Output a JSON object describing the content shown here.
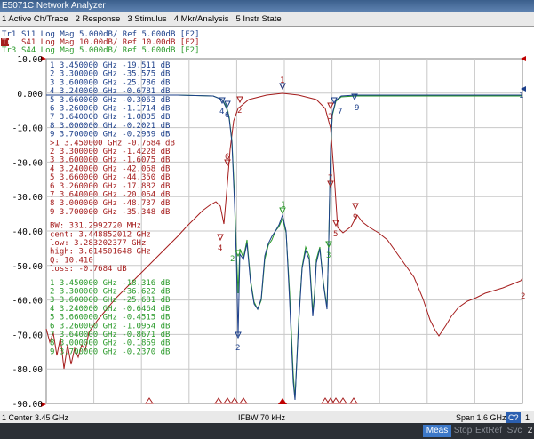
{
  "window_title": "E5071C Network Analyzer",
  "menu": [
    "1 Active Ch/Trace",
    "2 Response",
    "3 Stimulus",
    "4 Mkr/Analysis",
    "5 Instr State"
  ],
  "traces": [
    {
      "name": "Tr1",
      "text": " S11 Log Mag 5.000dB/ Ref 5.000dB [F2]",
      "color": "#1c3f8a",
      "active": false
    },
    {
      "name": "Tr2",
      "text": " S41 Log Mag 10.00dB/ Ref 10.00dB [F2]",
      "color": "#a51d1d",
      "active": true
    },
    {
      "name": "Tr3",
      "text": " S44 Log Mag 5.000dB/ Ref 5.000dB [F2]",
      "color": "#2a9a2a",
      "active": false
    }
  ],
  "yticks": [
    "10.00",
    "0.000",
    "-10.00",
    "-20.00",
    "-30.00",
    "-40.00",
    "-50.00",
    "-60.00",
    "-70.00",
    "-80.00",
    "-90.00"
  ],
  "marker_table_tr1": [
    " 1  3.450000 GHz -19.511 dB",
    " 2  3.300000 GHz -35.575 dB",
    " 3  3.600000 GHz -25.786 dB",
    " 4  3.240000 GHz -0.6781 dB",
    " 5  3.660000 GHz -0.3063 dB",
    " 6  3.260000 GHz -1.1714 dB",
    " 7  3.640000 GHz -1.0805 dB",
    " 8  3.000000 GHz -0.2021 dB",
    " 9  3.700000 GHz -0.2939 dB"
  ],
  "marker_table_tr2": [
    ">1  3.450000 GHz -0.7684 dB",
    " 2  3.300000 GHz -1.4228 dB",
    " 3  3.600000 GHz -1.6075 dB",
    " 4  3.240000 GHz -42.068 dB",
    " 5  3.660000 GHz -44.350 dB",
    " 6  3.260000 GHz -17.882 dB",
    " 7  3.640000 GHz -20.064 dB",
    " 8  3.000000 GHz -48.737 dB",
    " 9  3.700000 GHz -35.348 dB"
  ],
  "bw_stats": [
    "   BW:  331.2992720 MHz",
    " cent:  3.448852012 GHz",
    "  low:  3.283202377 GHz",
    " high:  3.614501648 GHz",
    "    Q:  10.410",
    " loss:  -0.7684 dB"
  ],
  "marker_table_tr3": [
    " 1  3.450000 GHz -18.316 dB",
    " 2  3.300000 GHz -36.622 dB",
    " 3  3.600000 GHz -25.681 dB",
    " 4  3.240000 GHz -0.6464 dB",
    " 5  3.660000 GHz -0.4515 dB",
    " 6  3.260000 GHz -1.0954 dB",
    " 7  3.640000 GHz -0.8671 dB",
    " 8  3.000000 GHz -0.1869 dB",
    " 9  3.700000 GHz -0.2370 dB"
  ],
  "colors": {
    "tr1": "#1c3f8a",
    "tr2": "#a51d1d",
    "tr3": "#2a9a2a",
    "ref_marker": "#c00000",
    "grid": "#c8c8c8"
  },
  "status": {
    "left": "1  Center 3.45 GHz",
    "center": "IFBW 70 kHz",
    "right": "Span 1.6 GHz",
    "c_badge": "C?",
    "one": "1"
  },
  "bottom_buttons": [
    "Meas",
    "Stop",
    "ExtRef",
    "Svc",
    "2"
  ]
}
